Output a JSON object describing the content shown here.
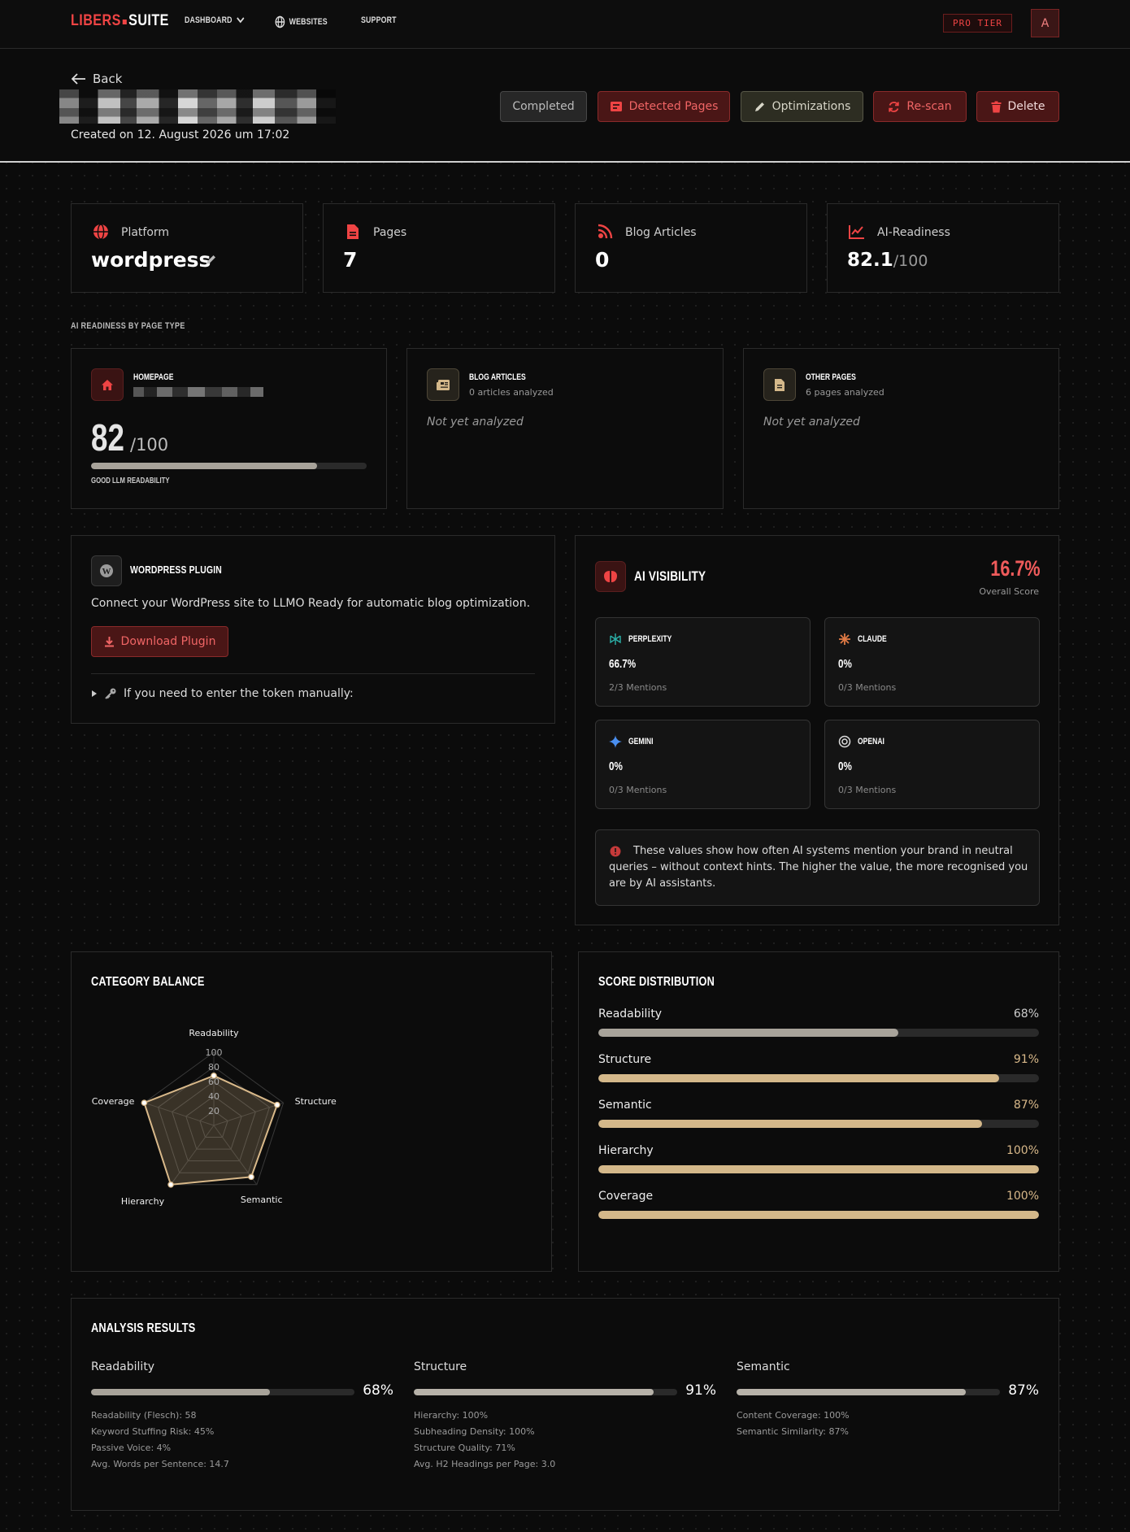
{
  "nav": {
    "logo_part1": "LIBERS",
    "logo_part2": "SUITE",
    "dashboard": "DASHBOARD",
    "websites": "WEBSITES",
    "support": "SUPPORT",
    "pro_tier": "PRO TIER",
    "avatar_initial": "A"
  },
  "header": {
    "back": "Back",
    "created": "Created on 12. August 2026 um 17:02",
    "buttons": {
      "completed": "Completed",
      "detected_pages": "Detected Pages",
      "optimizations": "Optimizations",
      "rescan": "Re-scan",
      "delete": "Delete"
    }
  },
  "stats": {
    "platform_label": "Platform",
    "platform_value": "wordpress",
    "pages_label": "Pages",
    "pages_value": "7",
    "blog_label": "Blog Articles",
    "blog_value": "0",
    "ai_label": "AI-Readiness",
    "ai_value": "82.1",
    "ai_suffix": "/100"
  },
  "page_type": {
    "section_label": "AI READINESS BY PAGE TYPE",
    "homepage": {
      "title": "HOMEPAGE",
      "score": "82",
      "suffix": "/100",
      "progress": 0.82,
      "rating": "GOOD LLM READABILITY"
    },
    "blog": {
      "title": "BLOG ARTICLES",
      "sub": "0 articles analyzed",
      "status": "Not yet analyzed"
    },
    "other": {
      "title": "OTHER PAGES",
      "sub": "6 pages analyzed",
      "status": "Not yet analyzed"
    }
  },
  "plugin": {
    "title": "WORDPRESS PLUGIN",
    "description": "Connect your WordPress site to LLMO Ready for automatic blog optimization.",
    "download": "Download Plugin",
    "token_toggle": "If you need to enter the token manually:"
  },
  "ai_visibility": {
    "title": "AI VISIBILITY",
    "overall": "16.7%",
    "overall_label": "Overall Score",
    "engines": [
      {
        "name": "PERPLEXITY",
        "pct": "66.7%",
        "mentions": "2/3 Mentions"
      },
      {
        "name": "CLAUDE",
        "pct": "0%",
        "mentions": "0/3 Mentions"
      },
      {
        "name": "GEMINI",
        "pct": "0%",
        "mentions": "0/3 Mentions"
      },
      {
        "name": "OPENAI",
        "pct": "0%",
        "mentions": "0/3 Mentions"
      }
    ],
    "info": "These values show how often AI systems mention your brand in neutral queries – without context hints. The higher the value, the more recognised you are by AI assistants."
  },
  "category_balance": {
    "title": "CATEGORY BALANCE"
  },
  "chart_data": {
    "type": "radar",
    "axes": [
      "Readability",
      "Structure",
      "Semantic",
      "Hierarchy",
      "Coverage"
    ],
    "values": [
      68,
      91,
      87,
      100,
      100
    ],
    "rlim": [
      0,
      100
    ],
    "ticks": [
      "20",
      "40",
      "60",
      "80",
      "100"
    ],
    "color": "#d9b98a"
  },
  "score_distribution": {
    "title": "SCORE DISTRIBUTION",
    "items": [
      {
        "label": "Readability",
        "pct": "68%",
        "value": 0.68,
        "color": "#a8a39a"
      },
      {
        "label": "Structure",
        "pct": "91%",
        "value": 0.91,
        "color": "#d4b88a"
      },
      {
        "label": "Semantic",
        "pct": "87%",
        "value": 0.87,
        "color": "#d4b88a"
      },
      {
        "label": "Hierarchy",
        "pct": "100%",
        "value": 1.0,
        "color": "#d4b88a"
      },
      {
        "label": "Coverage",
        "pct": "100%",
        "value": 1.0,
        "color": "#d4b88a"
      }
    ]
  },
  "analysis": {
    "title": "ANALYSIS RESULTS",
    "columns": [
      {
        "label": "Readability",
        "pct": "68%",
        "value": 0.68,
        "details": [
          "Readability (Flesch): 58",
          "Keyword Stuffing Risk: 45%",
          "Passive Voice: 4%",
          "Avg. Words per Sentence: 14.7"
        ]
      },
      {
        "label": "Structure",
        "pct": "91%",
        "value": 0.91,
        "details": [
          "Hierarchy: 100%",
          "Subheading Density: 100%",
          "Structure Quality: 71%",
          "Avg. H2 Headings per Page: 3.0"
        ]
      },
      {
        "label": "Semantic",
        "pct": "87%",
        "value": 0.87,
        "details": [
          "Content Coverage: 100%",
          "Semantic Similarity: 87%"
        ]
      }
    ]
  }
}
